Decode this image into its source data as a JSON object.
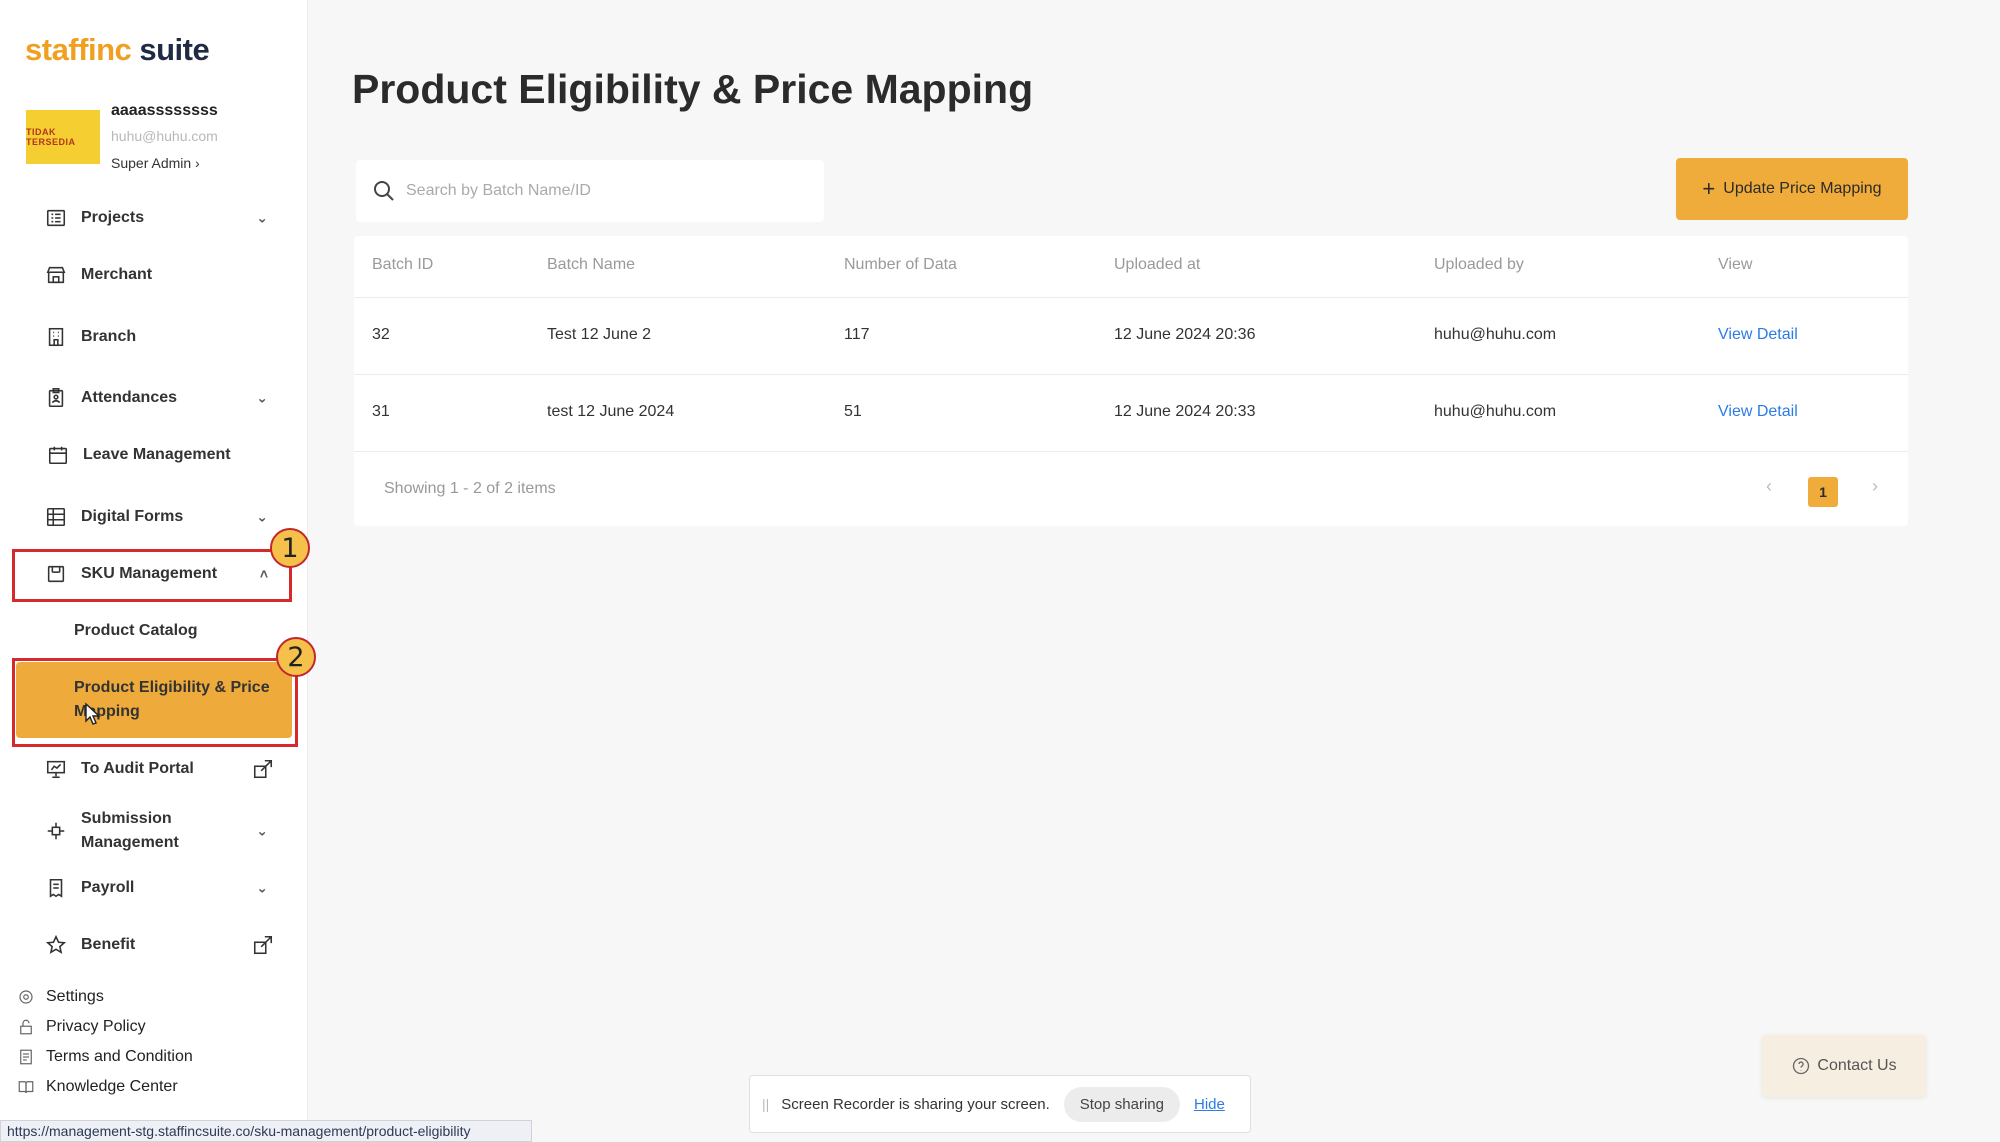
{
  "app": {
    "logo_part1": "staffinc",
    "logo_part2": " suite"
  },
  "profile": {
    "name": "aaaassssssss",
    "email": "huhu@huhu.com",
    "role": "Super Admin ›",
    "avatar_text": "TIDAK TERSEDIA"
  },
  "sidebar": {
    "items": [
      {
        "label": "Projects",
        "icon": "grid-list-icon"
      },
      {
        "label": "Merchant",
        "icon": "store-icon"
      },
      {
        "label": "Branch",
        "icon": "building-icon"
      },
      {
        "label": "Attendances",
        "icon": "clipboard-person-icon"
      },
      {
        "label": "Leave Management",
        "icon": "calendar-icon"
      },
      {
        "label": "Digital Forms",
        "icon": "form-grid-icon"
      },
      {
        "label": "SKU Management",
        "icon": "box-icon"
      },
      {
        "label": "Product Catalog"
      },
      {
        "label": "Product Eligibility & Price Mapping"
      },
      {
        "label": "To Audit Portal",
        "icon": "presentation-icon"
      },
      {
        "label": "Submission Management",
        "icon": "flow-icon"
      },
      {
        "label": "Payroll",
        "icon": "receipt-icon"
      },
      {
        "label": "Benefit",
        "icon": "star-icon"
      }
    ],
    "footer": [
      {
        "label": "Settings",
        "icon": "gear-icon"
      },
      {
        "label": "Privacy Policy",
        "icon": "lock-icon"
      },
      {
        "label": "Terms and Condition",
        "icon": "document-icon"
      },
      {
        "label": "Knowledge Center",
        "icon": "book-icon"
      }
    ]
  },
  "annotations": {
    "badge1": "1",
    "badge2": "2"
  },
  "main": {
    "title": "Product Eligibility & Price Mapping",
    "search_placeholder": "Search by Batch Name/ID",
    "update_button": "Update Price Mapping",
    "table": {
      "headers": [
        "Batch ID",
        "Batch Name",
        "Number of Data",
        "Uploaded at",
        "Uploaded by",
        "View"
      ],
      "rows": [
        {
          "batch_id": "32",
          "batch_name": "Test 12 June 2",
          "count": "117",
          "uploaded_at": "12 June 2024 20:36",
          "uploaded_by": "huhu@huhu.com",
          "view": "View Detail"
        },
        {
          "batch_id": "31",
          "batch_name": "test 12 June 2024",
          "count": "51",
          "uploaded_at": "12 June 2024 20:33",
          "uploaded_by": "huhu@huhu.com",
          "view": "View Detail"
        }
      ]
    },
    "showing": "Showing 1 - 2 of 2 items",
    "page": "1"
  },
  "share_bar": {
    "message": "Screen Recorder is sharing your screen.",
    "stop": "Stop sharing",
    "hide": "Hide"
  },
  "contact": "Contact Us",
  "status_url": "https://management-stg.staffincsuite.co/sku-management/product-eligibility",
  "colors": {
    "accent": "#f0ac3a",
    "link": "#2c7be5",
    "annotation": "#d52a2a"
  }
}
